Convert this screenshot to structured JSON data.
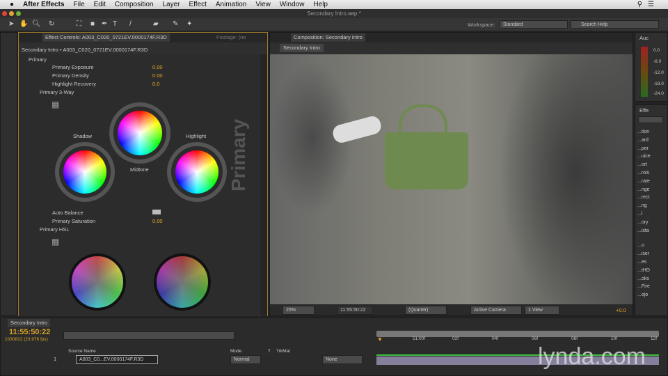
{
  "menubar": {
    "app": "After Effects",
    "items": [
      "File",
      "Edit",
      "Composition",
      "Layer",
      "Effect",
      "Animation",
      "View",
      "Window",
      "Help"
    ]
  },
  "window": {
    "title": "Secondary Intro.aep *"
  },
  "toolbar": {
    "workspace_label": "Workspace:",
    "workspace_value": "Standard",
    "search_placeholder": "Search Help"
  },
  "effect_controls": {
    "tab": "Effect Controls: A003_C020_0721EV.0000174F.R3D",
    "footage_tab": "Footage: (no",
    "header": "Secondary Intro • A003_C020_0721EV.0000174F.R3D",
    "primary": "Primary",
    "props": [
      {
        "label": "Primary Exposure",
        "value": "0.00"
      },
      {
        "label": "Primary Density",
        "value": "0.00"
      },
      {
        "label": "Highlight Recovery",
        "value": "0.0"
      }
    ],
    "three_way": "Primary 3-Way",
    "shadow": "Shadow",
    "midtone": "Midtone",
    "highlight": "Highlight",
    "watermark": "Primary",
    "auto_balance": "Auto Balance",
    "saturation_label": "Primary Saturation",
    "saturation_value": "0.00",
    "hsl": "Primary HSL"
  },
  "composition": {
    "tab": "Composition: Secondary Intro",
    "subtab": "Secondary Intro",
    "zoom": "25%",
    "timecode": "11:55:50:22",
    "resolution": "(Quarter)",
    "camera": "Active Camera",
    "views": "1 View",
    "exposure": "+0.0"
  },
  "audio": {
    "tab": "Auc",
    "levels": [
      "0.0",
      "-6.0",
      "-12.0",
      "-18.0",
      "-24.0"
    ]
  },
  "effects_panel": {
    "tab": "Effe",
    "items": [
      "...tion",
      "...ard",
      "...per",
      "...uice",
      "...ort",
      "...rols",
      "...rate",
      "...nge",
      "...rect",
      "...ng",
      "...l",
      "...ory",
      "...ista",
      "...o",
      "...iser",
      "...es",
      "...tHD",
      "...oks",
      "...Fire",
      "...ojo"
    ]
  },
  "timeline": {
    "tab": "Secondary Intro",
    "timecode": "11:55:50:22",
    "frames": "1030822 (23.976 fps)",
    "columns": {
      "source": "Source Name",
      "mode": "Mode",
      "t": "T",
      "trkmat": "TrkMat"
    },
    "ruler": [
      "51:00f",
      "02f",
      "04f",
      "06f",
      "08f",
      "10f",
      "12f"
    ],
    "layer": {
      "index": "1",
      "name": "A003_C0...EV.0000174F.R3D",
      "mode": "Normal",
      "trkmat": "None"
    }
  },
  "watermark": {
    "text": "lynda.com"
  },
  "colors": {
    "accent": "#e8a82a",
    "bag": "#6f8a4f",
    "timecode": "#d9a52a"
  }
}
